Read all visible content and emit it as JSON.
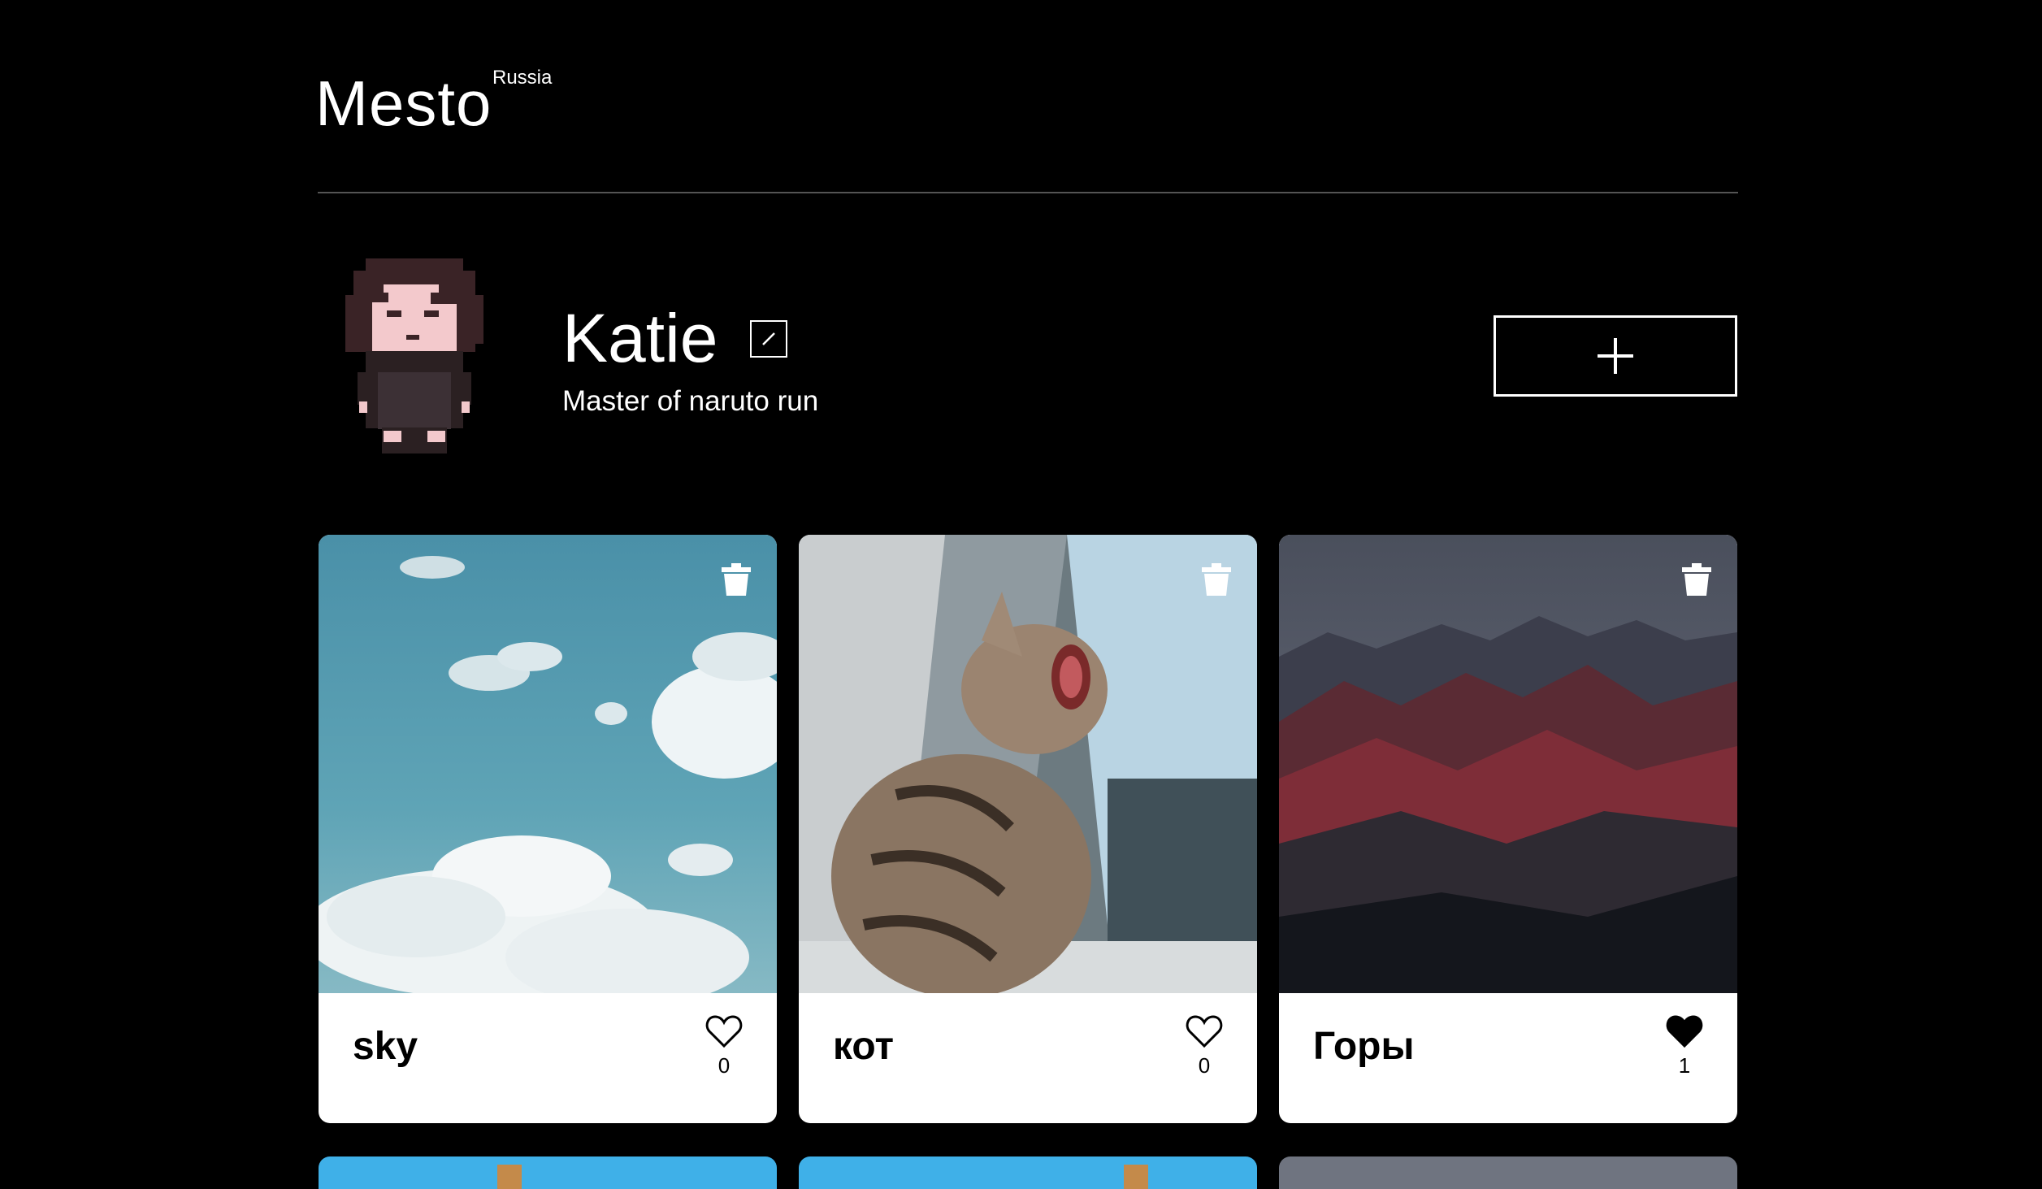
{
  "header": {
    "logo": "Mesto",
    "logo_sub": "Russia"
  },
  "profile": {
    "name": "Katie",
    "about": "Master of naruto run"
  },
  "icons": {
    "edit": "pencil-icon",
    "add": "plus-icon",
    "delete": "trash-icon",
    "like": "heart-icon"
  },
  "cards": [
    {
      "title": "sky",
      "likes": "0",
      "liked": false
    },
    {
      "title": "кот",
      "likes": "0",
      "liked": false
    },
    {
      "title": "Горы",
      "likes": "1",
      "liked": true
    }
  ],
  "colors": {
    "background": "#000000",
    "card": "#ffffff",
    "divider": "#545454"
  }
}
